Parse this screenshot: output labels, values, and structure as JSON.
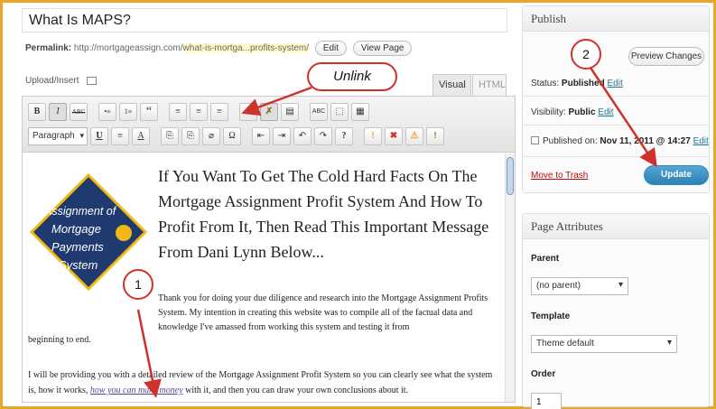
{
  "post": {
    "title": "What Is MAPS?",
    "permalink_label": "Permalink:",
    "permalink_base": "http://mortgageassign.com/",
    "permalink_slug": "what-is-mortga...profits-system/",
    "edit_label": "Edit",
    "view_page_label": "View Page"
  },
  "editor": {
    "upload_insert_label": "Upload/Insert",
    "tab_visual": "Visual",
    "tab_html": "HTML",
    "format_select": "Paragraph",
    "toolbar_row1": [
      "B",
      "I",
      "ABC",
      "•≡",
      "1≡",
      "“",
      "≡",
      "≡",
      "≡",
      "🔗",
      "✂",
      "▤",
      "ABC",
      "⬚",
      "▦"
    ],
    "toolbar_row2": [
      "U",
      "≡",
      "A",
      "⎘",
      "⎘",
      "⌀",
      "Ω",
      "⇤",
      "⇥",
      "↶",
      "↷",
      "?",
      "!",
      "✖",
      "⚠",
      "!"
    ],
    "headline": "If You Want To Get The Cold Hard Facts On The Mortgage Assignment Profit System And How To Profit From It, Then Read This Important Message From Dani Lynn Below...",
    "paragraph1": "Thank you for doing your due diligence and research into the Mortgage Assignment Profits System. My intention in creating this website was to compile all of the factual data and knowledge I've amassed from working this system and testing it from",
    "paragraph1_end": "beginning to end.",
    "paragraph2_before": "I will be providing you with a detailed review of the Mortgage Assignment Profit System so you can clearly see what the system is, how it works, ",
    "paragraph2_link": "how you can make money",
    "paragraph2_after": " with it, and then you can draw your own conclusions about it."
  },
  "logo": {
    "lines": [
      "Assignment of",
      "Mortgage",
      "Payments",
      "System"
    ]
  },
  "publish": {
    "heading": "Publish",
    "preview_changes": "Preview Changes",
    "status_label": "Status:",
    "status_value": "Published",
    "visibility_label": "Visibility:",
    "visibility_value": "Public",
    "edit_link": "Edit",
    "published_on_label": "Published on:",
    "published_on_value": "Nov 11, 2011 @ 14:27",
    "move_to_trash": "Move to Trash",
    "update": "Update"
  },
  "attributes": {
    "heading": "Page Attributes",
    "parent_label": "Parent",
    "parent_value": "(no parent)",
    "template_label": "Template",
    "template_value": "Theme default",
    "order_label": "Order",
    "order_value": "1"
  },
  "annotations": {
    "unlink": "Unlink",
    "step1": "1",
    "step2": "2"
  },
  "colors": {
    "annotation": "#d0312d",
    "frame": "#e6a82a",
    "link": "#21759b",
    "update_button": "#2e7fb4",
    "logo_navy": "#1f3a6e",
    "logo_gold": "#f2b816"
  }
}
